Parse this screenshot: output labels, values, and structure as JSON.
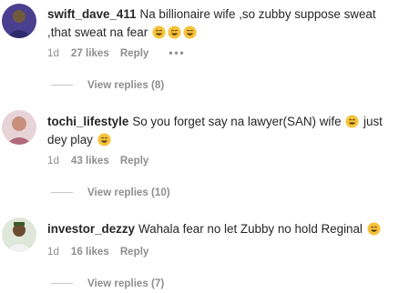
{
  "comments": [
    {
      "username": "swift_dave_411",
      "text_part1": "Na billionaire wife ,so zubby suppose sweat ,that sweat na fear",
      "age": "1d",
      "likes": "27 likes",
      "reply_label": "Reply",
      "more_label": "•••",
      "view_replies": "View replies (8)"
    },
    {
      "username": "tochi_lifestyle",
      "text_part1": "So you forget say na lawyer(SAN) wife",
      "text_part2": "just dey play",
      "age": "1d",
      "likes": "43 likes",
      "reply_label": "Reply",
      "view_replies": "View replies (10)"
    },
    {
      "username": "investor_dezzy",
      "text_part1": "Wahala fear no let Zubby no hold Reginal",
      "age": "1d",
      "likes": "16 likes",
      "reply_label": "Reply",
      "view_replies": "View replies (7)"
    }
  ],
  "emoji": {
    "name": "grinning-sweat-emoji",
    "face_color": "#f5c33b",
    "mouth_color": "#5a3a0a"
  },
  "colors": {
    "text": "#262626",
    "secondary": "#8e8e8e"
  }
}
